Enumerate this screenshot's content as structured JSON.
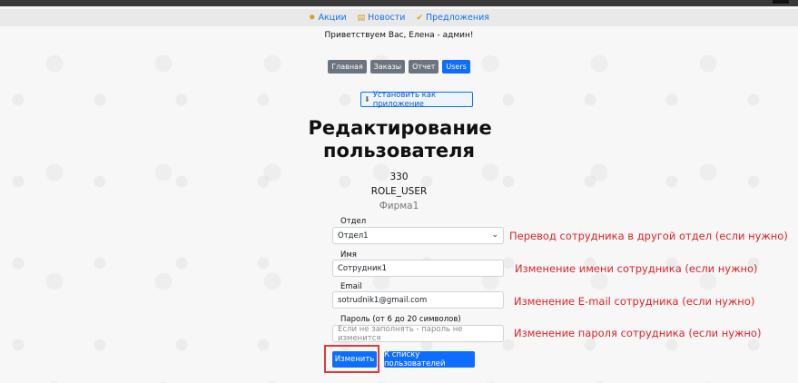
{
  "promo_bar": {
    "items": [
      {
        "label": "Акции",
        "icon": "sale-badge-icon"
      },
      {
        "label": "Новости",
        "icon": "news-icon"
      },
      {
        "label": "Предложения",
        "icon": "check-icon"
      }
    ]
  },
  "greeting": "Приветствуем Вас, Елена - админ!",
  "nav": {
    "items": [
      {
        "label": "Главная",
        "active": false
      },
      {
        "label": "Заказы",
        "active": false
      },
      {
        "label": "Отчет",
        "active": false
      },
      {
        "label": "Users",
        "active": true
      }
    ]
  },
  "install_button": "Установить как приложение",
  "page_title": "Редактирование пользователя",
  "user": {
    "id": "330",
    "role": "ROLE_USER",
    "firm": "Фирма1"
  },
  "form": {
    "department": {
      "label": "Отдел",
      "value": "Отдел1"
    },
    "name": {
      "label": "Имя",
      "value": "Сотрудник1"
    },
    "email": {
      "label": "Email",
      "value": "sotrudnik1@gmail.com"
    },
    "password": {
      "label": "Пароль (от 6 до 20 символов)",
      "placeholder": "Если не заполнять - пароль не изменится"
    },
    "submit_label": "Изменить",
    "back_label": "К списку пользователей"
  },
  "annotations": {
    "department": "Перевод сотрудника в другой отдел (если нужно)",
    "name": "Изменение имени сотрудника (если нужно)",
    "email": "Изменение E-mail сотрудника (если нужно)",
    "password": "Изменение пароля сотрудника (если нужно)"
  },
  "colors": {
    "primary": "#0d6efd",
    "secondary": "#6c757d",
    "annotation": "#e02424"
  }
}
